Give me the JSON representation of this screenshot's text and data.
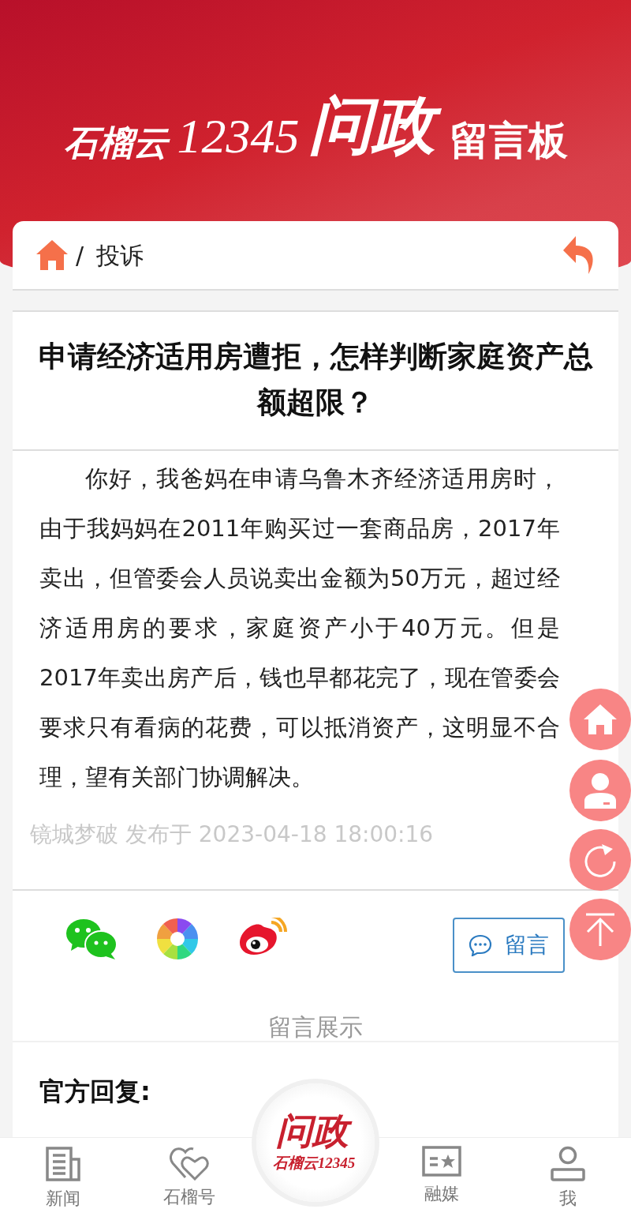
{
  "header": {
    "logo_brand": "石榴云",
    "logo_number": "12345",
    "logo_title": "问政",
    "logo_subtitle": "留言板"
  },
  "breadcrumb": {
    "separator": "/",
    "current": "投诉"
  },
  "post": {
    "title": "申请经济适用房遭拒，怎样判断家庭资产总额超限？",
    "body": "你好，我爸妈在申请乌鲁木齐经济适用房时，由于我妈妈在2011年购买过一套商品房，2017年卖出，但管委会人员说卖出金额为50万元，超过经济适用房的要求，家庭资产小于40万元。但是2017年卖出房产后，钱也早都花完了，现在管委会要求只有看病的花费，可以抵消资产，这明显不合理，望有关部门协调解决。",
    "author": "镜城梦破",
    "published": "发布于 2023-04-18 18:00:16"
  },
  "share": {
    "comment_button": "留言"
  },
  "comments": {
    "heading": "留言展示",
    "official_reply_label": "官方回复:"
  },
  "float_buttons": [
    {
      "kind": "home"
    },
    {
      "kind": "user"
    },
    {
      "kind": "refresh"
    },
    {
      "kind": "top"
    }
  ],
  "bottom_nav": {
    "center": {
      "title": "问政",
      "brand": "石榴云12345"
    },
    "items": [
      {
        "kind": "news",
        "label": "新闻"
      },
      {
        "kind": "hearts",
        "label": "石榴号"
      },
      {
        "kind": "media",
        "label": "融媒"
      },
      {
        "kind": "user",
        "label": "我"
      }
    ]
  }
}
